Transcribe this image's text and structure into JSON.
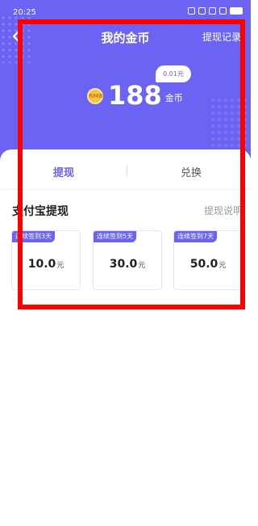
{
  "status_bar": {
    "time": "20:25"
  },
  "nav": {
    "title": "我的金币",
    "record_link": "提现记录"
  },
  "balance": {
    "rate": "0.01元",
    "coin_icon_text": "RMB",
    "amount": "188",
    "unit": "金币"
  },
  "tabs": [
    {
      "label": "提现",
      "active": true
    },
    {
      "label": "兑换",
      "active": false
    }
  ],
  "section": {
    "title": "支付宝提现",
    "help": "提现说明"
  },
  "options": [
    {
      "tag": "连续签到3天",
      "amount": "10.0",
      "unit": "元"
    },
    {
      "tag": "连续签到5天",
      "amount": "30.0",
      "unit": "元"
    },
    {
      "tag": "连续签到7天",
      "amount": "50.0",
      "unit": "元"
    }
  ],
  "colors": {
    "primary": "#6a63f4",
    "highlight": "#ff0000",
    "coin": "#f6c344"
  }
}
